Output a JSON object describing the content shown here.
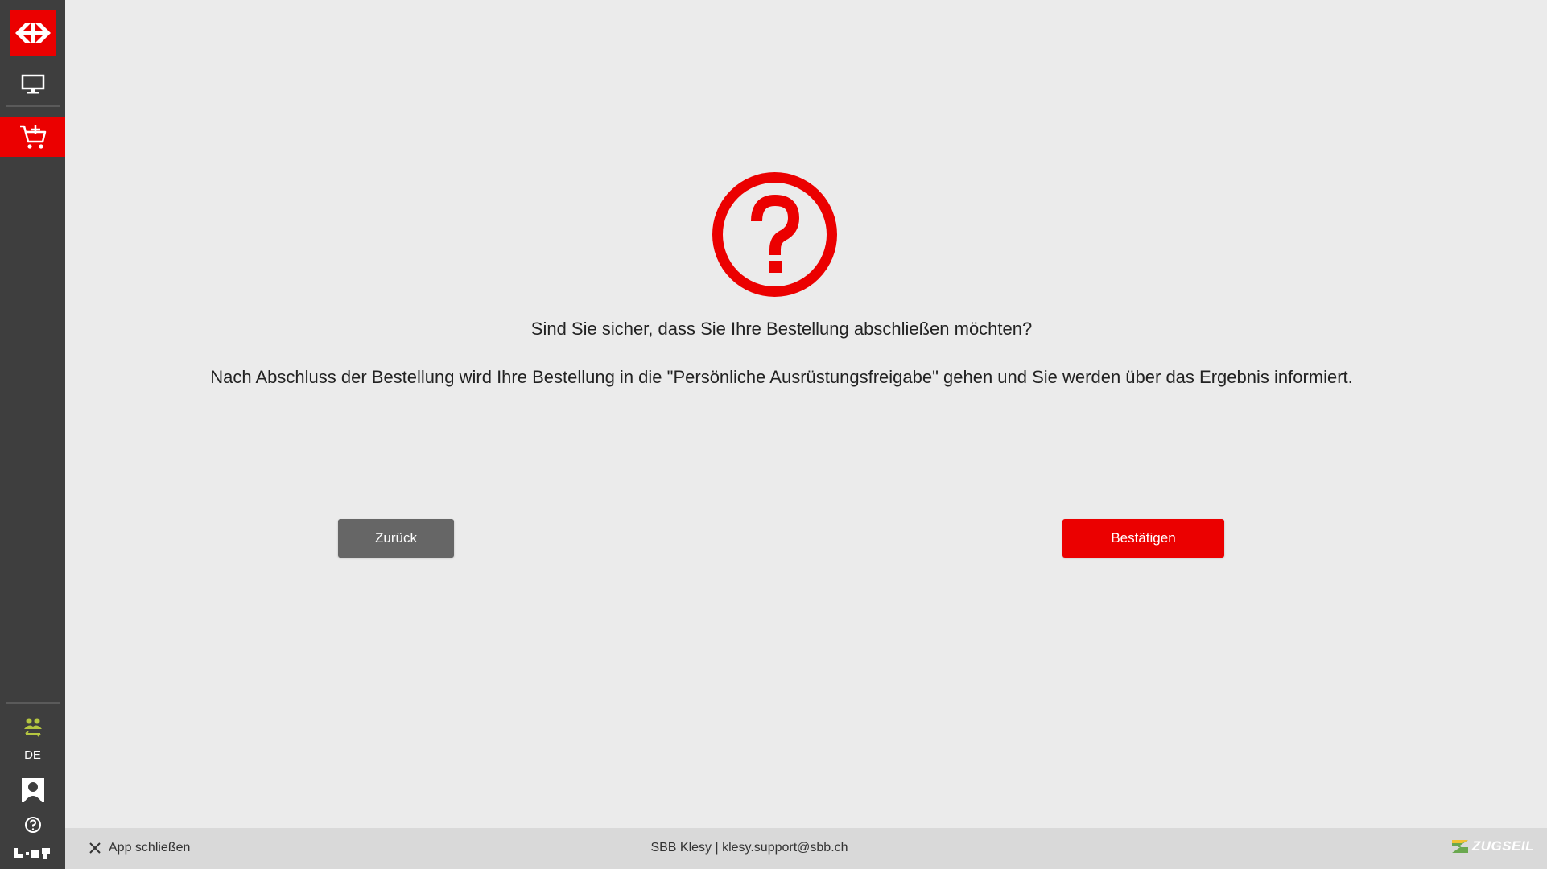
{
  "sidebar": {
    "logo_icon": "sbb-logo-icon",
    "items": [
      {
        "icon": "monitor-icon",
        "active": false
      },
      {
        "icon": "cart-add-icon",
        "active": true
      }
    ],
    "language": "DE",
    "accent_color": "#eb0000"
  },
  "dialog": {
    "icon": "question-circle-icon",
    "title": "Sind Sie sicher, dass Sie Ihre Bestellung abschließen möchten?",
    "message": "Nach Abschluss der Bestellung wird Ihre Bestellung in die \"Persönliche Ausrüstungsfreigabe\" gehen und Sie werden über das Ergebnis informiert.",
    "back_label": "Zurück",
    "confirm_label": "Bestätigen"
  },
  "footer": {
    "close_label": "App schließen",
    "center_text": "SBB Klesy | klesy.support@sbb.ch",
    "brand": "ZUGSEIL"
  }
}
